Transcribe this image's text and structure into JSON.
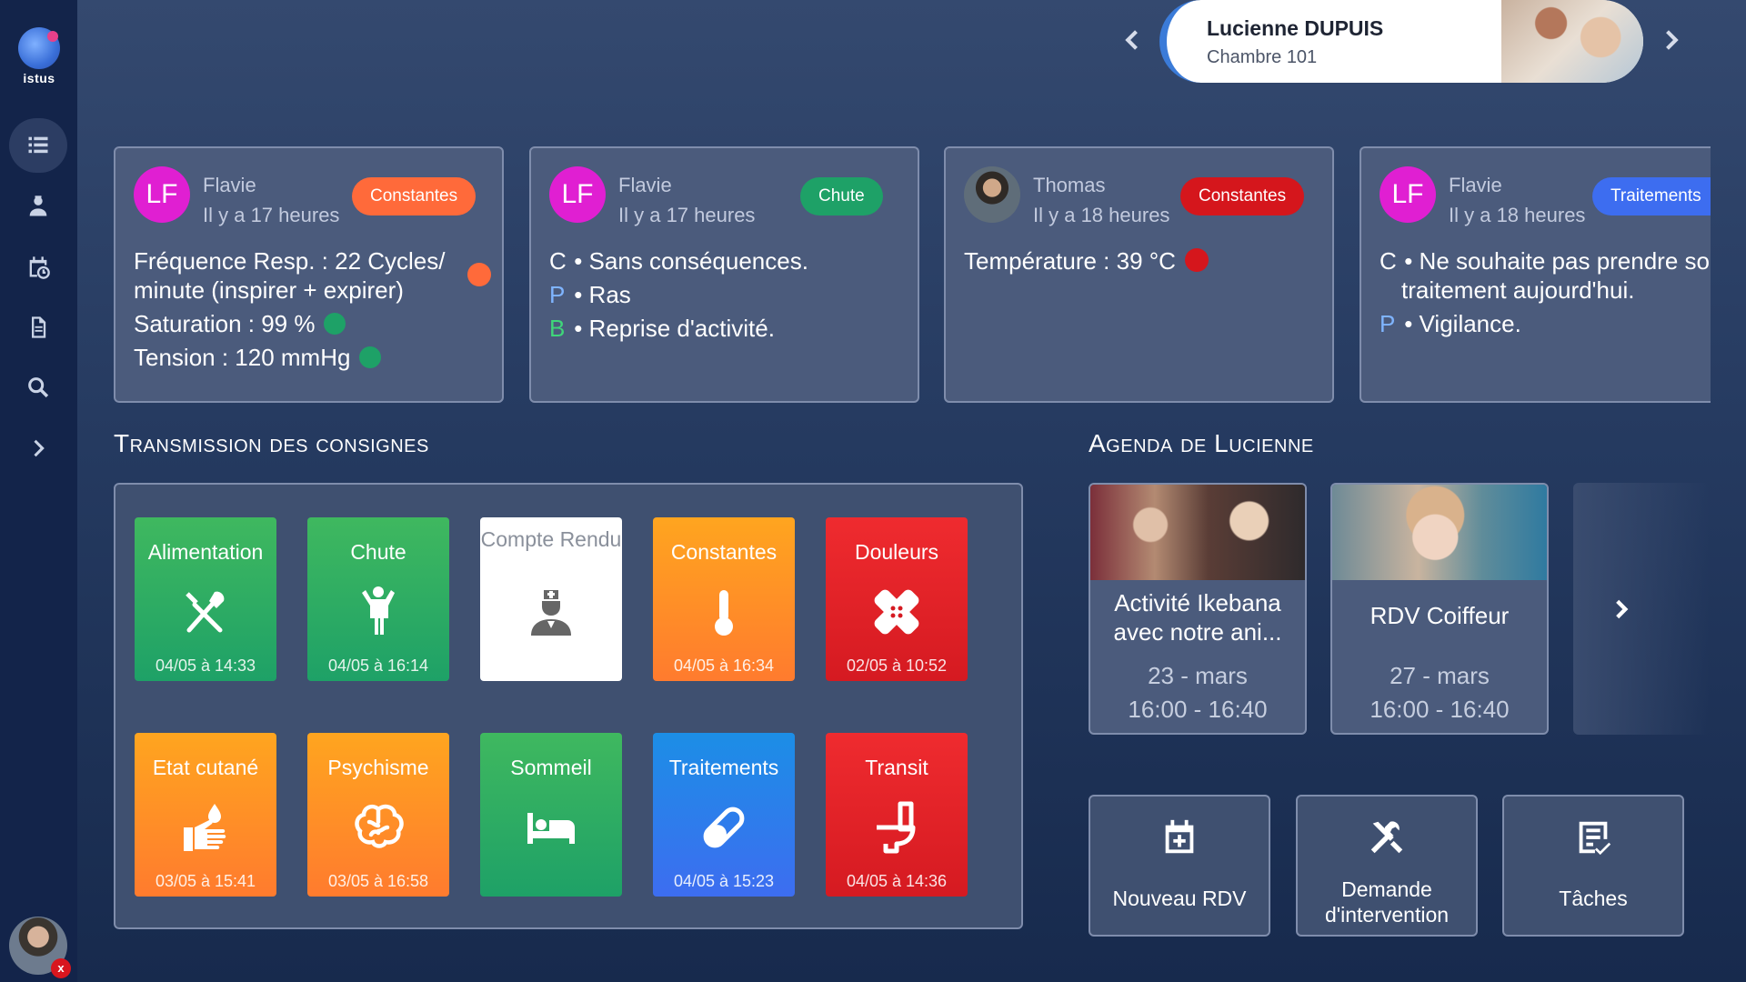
{
  "app": {
    "logo_text": "istus"
  },
  "patient": {
    "name": "Lucienne DUPUIS",
    "room": "Chambre 101"
  },
  "transmissions": [
    {
      "initials": "LF",
      "author": "Flavie",
      "time": "Il y a 17 heures",
      "tag": "Constantes",
      "tag_color": "#ff6a3a",
      "lines": [
        {
          "text": "Fréquence Resp. : 22 Cycles/ minute (inspirer + expirer)",
          "dot": "#ff6a3a"
        },
        {
          "text": "Saturation : 99 %",
          "dot": "#1ea167"
        },
        {
          "text": "Tension : 120 mmHg",
          "dot": "#1ea167"
        }
      ]
    },
    {
      "initials": "LF",
      "author": "Flavie",
      "time": "Il y a 17 heures",
      "tag": "Chute",
      "tag_color": "#1ea167",
      "lines": [
        {
          "letter": "C",
          "text": "• Sans conséquences."
        },
        {
          "letter": "P",
          "text": "• Ras",
          "letter_color": "#7fb4ff"
        },
        {
          "letter": "B",
          "text": "• Reprise d'activité.",
          "letter_color": "#3fd67a"
        }
      ]
    },
    {
      "initials": "",
      "author": "Thomas",
      "time": "Il y a 18 heures",
      "tag": "Constantes",
      "tag_color": "#d5161c",
      "lines": [
        {
          "text": "Température : 39 °C",
          "dot": "#d5161c"
        }
      ]
    },
    {
      "initials": "LF",
      "author": "Flavie",
      "time": "Il y a 18 heures",
      "tag": "Traitements",
      "tag_color": "#3d6df0",
      "lines": [
        {
          "letter": "C",
          "text": "• Ne souhaite pas prendre son traitement aujourd'hui."
        },
        {
          "letter": "P",
          "text": "• Vigilance.",
          "letter_color": "#7fb4ff"
        }
      ]
    }
  ],
  "consignes": {
    "title": "Transmission des consignes",
    "tiles": [
      {
        "label": "Alimentation",
        "date": "04/05 à 14:33",
        "icon": "fork-knife-icon"
      },
      {
        "label": "Chute",
        "date": "04/05 à 16:14",
        "icon": "person-icon"
      },
      {
        "label": "Compte Rendu",
        "date": "",
        "icon": "nurse-icon"
      },
      {
        "label": "Constantes",
        "date": "04/05 à 16:34",
        "icon": "thermometer-icon"
      },
      {
        "label": "Douleurs",
        "date": "02/05 à 10:52",
        "icon": "bandage-icon"
      },
      {
        "label": "Etat cutané",
        "date": "03/05 à 15:41",
        "icon": "hand-drop-icon"
      },
      {
        "label": "Psychisme",
        "date": "03/05 à 16:58",
        "icon": "brain-icon"
      },
      {
        "label": "Sommeil",
        "date": "",
        "icon": "bed-icon"
      },
      {
        "label": "Traitements",
        "date": "04/05 à 15:23",
        "icon": "pill-icon"
      },
      {
        "label": "Transit",
        "date": "04/05 à 14:36",
        "icon": "toilet-icon"
      }
    ]
  },
  "agenda": {
    "title": "Agenda de Lucienne",
    "events": [
      {
        "title": "Activité Ikebana avec notre ani...",
        "date": "23 - mars",
        "time": "16:00 - 16:40"
      },
      {
        "title": "RDV Coiffeur",
        "date": "27 - mars",
        "time": "16:00 - 16:40"
      }
    ]
  },
  "actions": [
    {
      "label": "Nouveau RDV",
      "icon": "calendar-plus-icon"
    },
    {
      "label": "Demande d'intervention",
      "icon": "tools-icon"
    },
    {
      "label": "Tâches",
      "icon": "task-list-icon"
    }
  ],
  "user": {
    "badge": "x"
  }
}
